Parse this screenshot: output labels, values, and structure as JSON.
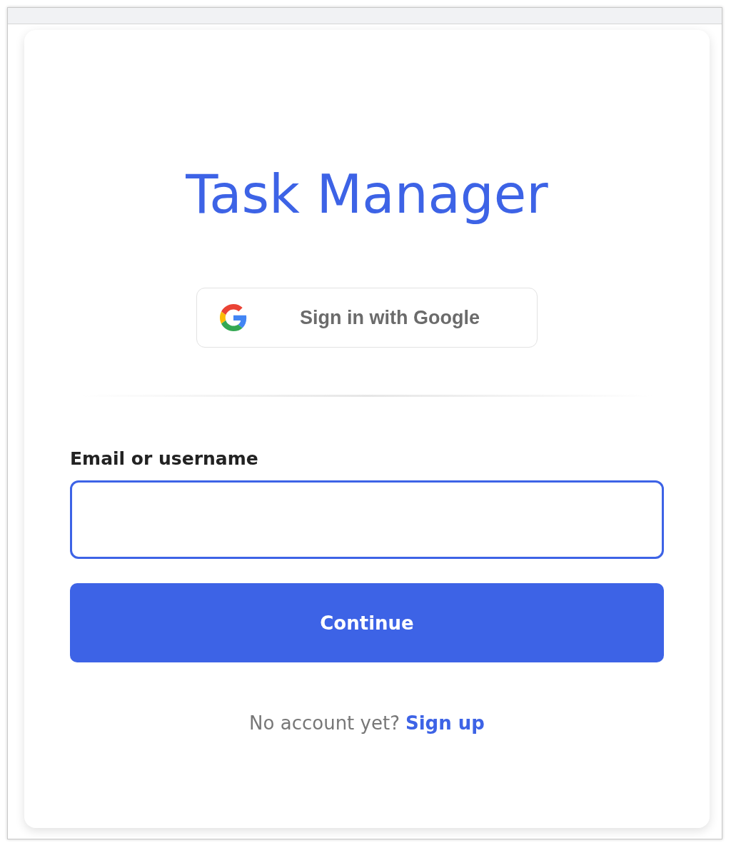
{
  "app_title": "Task Manager",
  "google_button": {
    "label": "Sign in with Google"
  },
  "login_field": {
    "label": "Email or username"
  },
  "continue_button": {
    "label": "Continue"
  },
  "footer": {
    "prompt": "No account yet?",
    "link": "Sign up"
  }
}
